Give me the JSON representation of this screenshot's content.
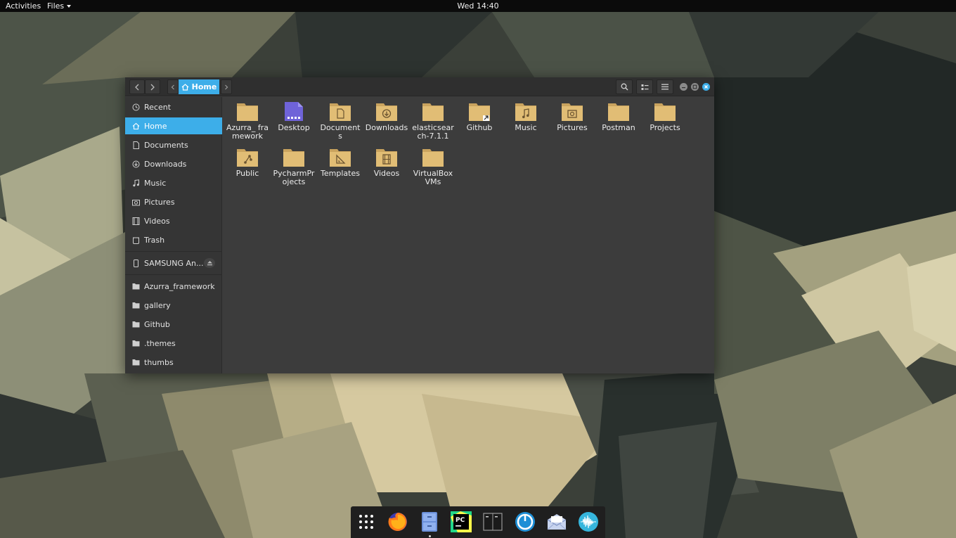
{
  "topbar": {
    "activities": "Activities",
    "app_menu": "Files",
    "clock": "Wed 14:40"
  },
  "window": {
    "path": {
      "current": "Home"
    },
    "sidebar": {
      "places": [
        {
          "label": "Recent",
          "icon": "clock-icon"
        },
        {
          "label": "Home",
          "icon": "home-icon",
          "active": true
        },
        {
          "label": "Documents",
          "icon": "document-icon"
        },
        {
          "label": "Downloads",
          "icon": "download-icon"
        },
        {
          "label": "Music",
          "icon": "music-icon"
        },
        {
          "label": "Pictures",
          "icon": "pictures-icon"
        },
        {
          "label": "Videos",
          "icon": "video-icon"
        },
        {
          "label": "Trash",
          "icon": "trash-icon"
        }
      ],
      "devices": [
        {
          "label": "SAMSUNG An...",
          "icon": "phone-icon"
        }
      ],
      "bookmarks": [
        {
          "label": "Azurra_framework",
          "icon": "folder-icon"
        },
        {
          "label": "gallery",
          "icon": "folder-icon"
        },
        {
          "label": "Github",
          "icon": "folder-icon"
        },
        {
          "label": ".themes",
          "icon": "folder-icon"
        },
        {
          "label": "thumbs",
          "icon": "folder-icon"
        }
      ]
    },
    "files": [
      {
        "name": "Azurra_ framework",
        "icon": "folder-icon"
      },
      {
        "name": "Desktop",
        "icon": "desktop-folder-icon"
      },
      {
        "name": "Documents",
        "icon": "documents-folder-icon"
      },
      {
        "name": "Downloads",
        "icon": "downloads-folder-icon"
      },
      {
        "name": "elasticsear ch-7.1.1",
        "icon": "folder-icon"
      },
      {
        "name": "Github",
        "icon": "folder-link-icon"
      },
      {
        "name": "Music",
        "icon": "music-folder-icon"
      },
      {
        "name": "Pictures",
        "icon": "pictures-folder-icon"
      },
      {
        "name": "Postman",
        "icon": "folder-icon"
      },
      {
        "name": "Projects",
        "icon": "folder-icon"
      },
      {
        "name": "Public",
        "icon": "public-folder-icon"
      },
      {
        "name": "PycharmPr ojects",
        "icon": "folder-icon"
      },
      {
        "name": "Templates",
        "icon": "templates-folder-icon"
      },
      {
        "name": "Videos",
        "icon": "videos-folder-icon"
      },
      {
        "name": "VirtualBox VMs",
        "icon": "folder-icon"
      }
    ]
  },
  "dock": {
    "apps": [
      "app-grid-icon",
      "firefox-icon",
      "files-icon",
      "pycharm-icon",
      "terminal-icon",
      "mailspring-icon",
      "mail-icon",
      "audio-recorder-icon"
    ]
  },
  "colors": {
    "accent": "#3daee9",
    "folder": "#e1bd75",
    "topbar": "#0b0b0b",
    "window_bg": "#3c3c3c"
  }
}
